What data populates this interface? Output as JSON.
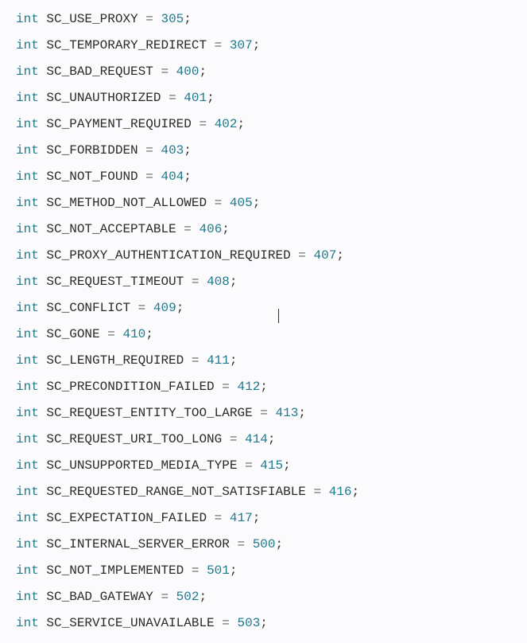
{
  "keyword": "int",
  "constants": [
    {
      "name": "SC_USE_PROXY",
      "value": 305
    },
    {
      "name": "SC_TEMPORARY_REDIRECT",
      "value": 307
    },
    {
      "name": "SC_BAD_REQUEST",
      "value": 400
    },
    {
      "name": "SC_UNAUTHORIZED",
      "value": 401
    },
    {
      "name": "SC_PAYMENT_REQUIRED",
      "value": 402
    },
    {
      "name": "SC_FORBIDDEN",
      "value": 403
    },
    {
      "name": "SC_NOT_FOUND",
      "value": 404
    },
    {
      "name": "SC_METHOD_NOT_ALLOWED",
      "value": 405
    },
    {
      "name": "SC_NOT_ACCEPTABLE",
      "value": 406
    },
    {
      "name": "SC_PROXY_AUTHENTICATION_REQUIRED",
      "value": 407
    },
    {
      "name": "SC_REQUEST_TIMEOUT",
      "value": 408
    },
    {
      "name": "SC_CONFLICT",
      "value": 409
    },
    {
      "name": "SC_GONE",
      "value": 410
    },
    {
      "name": "SC_LENGTH_REQUIRED",
      "value": 411
    },
    {
      "name": "SC_PRECONDITION_FAILED",
      "value": 412
    },
    {
      "name": "SC_REQUEST_ENTITY_TOO_LARGE",
      "value": 413
    },
    {
      "name": "SC_REQUEST_URI_TOO_LONG",
      "value": 414
    },
    {
      "name": "SC_UNSUPPORTED_MEDIA_TYPE",
      "value": 415
    },
    {
      "name": "SC_REQUESTED_RANGE_NOT_SATISFIABLE",
      "value": 416
    },
    {
      "name": "SC_EXPECTATION_FAILED",
      "value": 417
    },
    {
      "name": "SC_INTERNAL_SERVER_ERROR",
      "value": 500
    },
    {
      "name": "SC_NOT_IMPLEMENTED",
      "value": 501
    },
    {
      "name": "SC_BAD_GATEWAY",
      "value": 502
    },
    {
      "name": "SC_SERVICE_UNAVAILABLE",
      "value": 503
    }
  ]
}
